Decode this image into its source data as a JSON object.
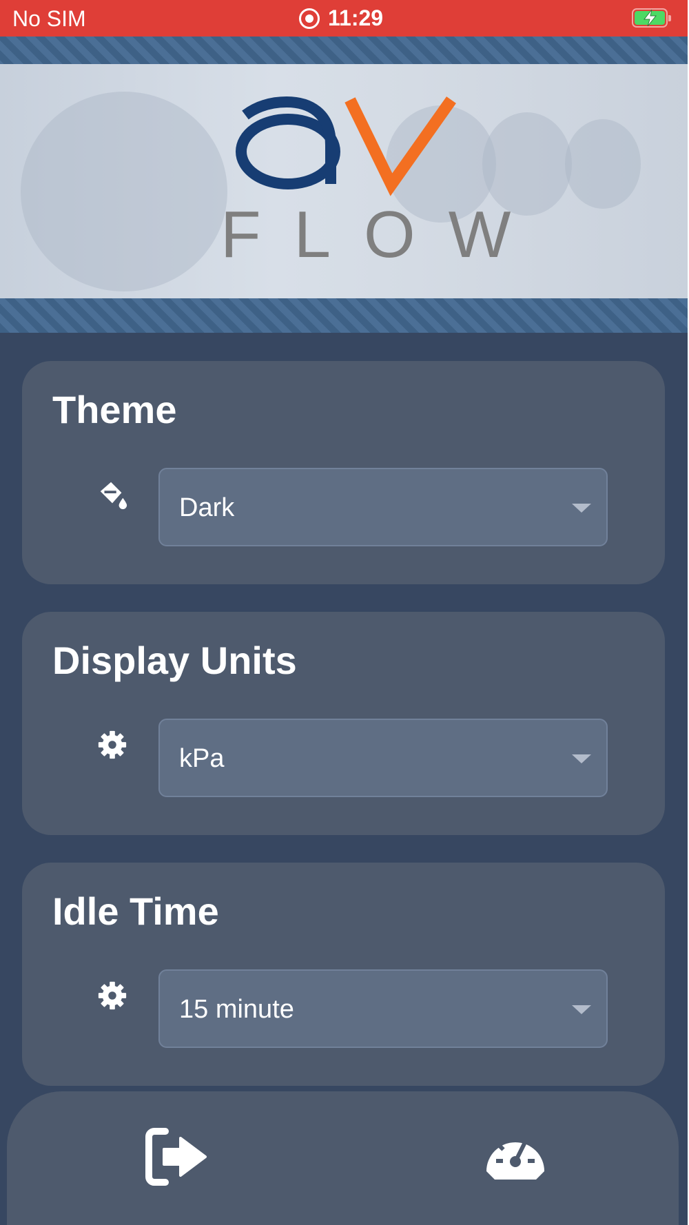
{
  "status_bar": {
    "carrier": "No SIM",
    "time": "11:29"
  },
  "header": {
    "logo_letters": "aV",
    "logo_word": "FLOW",
    "brand_colors": {
      "navy": "#173d73",
      "orange": "#f36f21",
      "gray": "#7f7f7f"
    }
  },
  "settings": {
    "theme": {
      "title": "Theme",
      "icon": "paint-bucket-icon",
      "value": "Dark"
    },
    "display_units": {
      "title": "Display Units",
      "icon": "gear-icon",
      "value": "kPa"
    },
    "idle_time": {
      "title": "Idle Time",
      "icon": "gear-icon",
      "value": "15 minute"
    }
  },
  "bottom_nav": {
    "left_icon": "logout-icon",
    "right_icon": "dashboard-icon"
  }
}
